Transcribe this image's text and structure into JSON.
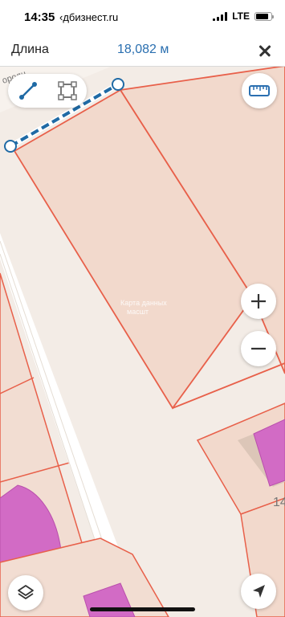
{
  "status_bar": {
    "time": "14:35",
    "site": "‹дбизнест.ru",
    "network": "LTE"
  },
  "measure": {
    "label": "Длина",
    "value": "18,082 м"
  },
  "map": {
    "street_label": "ородн",
    "parcel_label_line1": "Карта данных",
    "parcel_label_line2": "масшт",
    "house_number": "14"
  },
  "colors": {
    "accent": "#2a6fb0",
    "measure_line": "#1f6aa5",
    "parcel_border": "#e8604a",
    "parcel_fill": "#f2d9cc",
    "building_fill": "#d26bc5",
    "road": "#ffffff"
  },
  "icons": {
    "mode_line": "line-measure-icon",
    "mode_area": "area-measure-icon",
    "ruler": "ruler-icon",
    "zoom_in": "plus-icon",
    "zoom_out": "minus-icon",
    "layers": "layers-icon",
    "location": "location-arrow-icon",
    "close": "close-icon"
  }
}
